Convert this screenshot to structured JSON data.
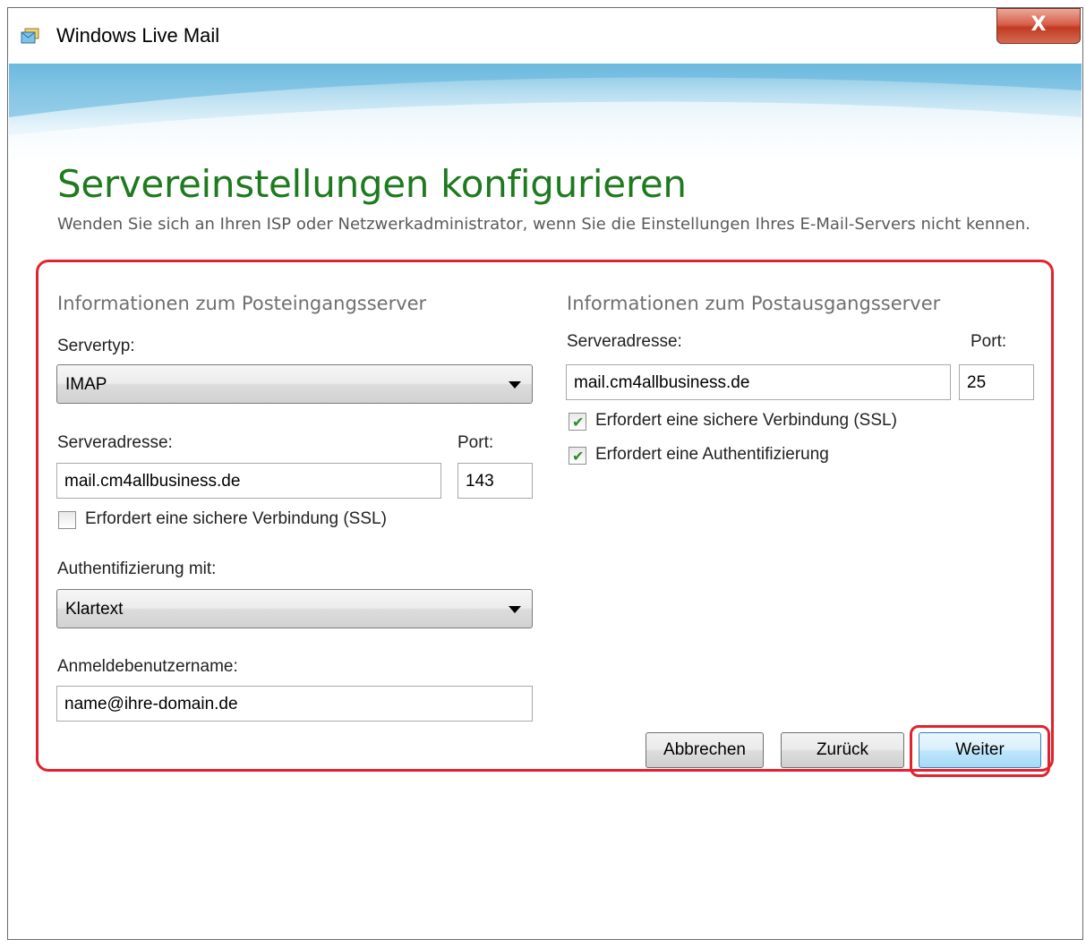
{
  "window": {
    "title": "Windows Live Mail",
    "close_label": "X"
  },
  "page": {
    "heading": "Servereinstellungen konfigurieren",
    "subtext": "Wenden Sie sich an Ihren ISP oder Netzwerkadministrator, wenn Sie die Einstellungen Ihres E-Mail-Servers nicht kennen."
  },
  "incoming": {
    "group_title": "Informationen zum Posteingangsserver",
    "server_type_label": "Servertyp:",
    "server_type_value": "IMAP",
    "server_address_label": "Serveradresse:",
    "server_address_value": "mail.cm4allbusiness.de",
    "port_label": "Port:",
    "port_value": "143",
    "ssl_label": "Erfordert eine sichere Verbindung (SSL)",
    "ssl_checked": false,
    "auth_label": "Authentifizierung mit:",
    "auth_value": "Klartext",
    "username_label": "Anmeldebenutzername:",
    "username_value": "name@ihre-domain.de"
  },
  "outgoing": {
    "group_title": "Informationen zum Postausgangsserver",
    "server_address_label": "Serveradresse:",
    "server_address_value": "mail.cm4allbusiness.de",
    "port_label": "Port:",
    "port_value": "25",
    "ssl_label": "Erfordert eine sichere Verbindung (SSL)",
    "ssl_checked": true,
    "auth_required_label": "Erfordert eine Authentifizierung",
    "auth_required_checked": true
  },
  "buttons": {
    "cancel": "Abbrechen",
    "back": "Zurück",
    "next": "Weiter"
  },
  "colors": {
    "heading": "#1e7a1e",
    "highlight": "#e1232f"
  }
}
